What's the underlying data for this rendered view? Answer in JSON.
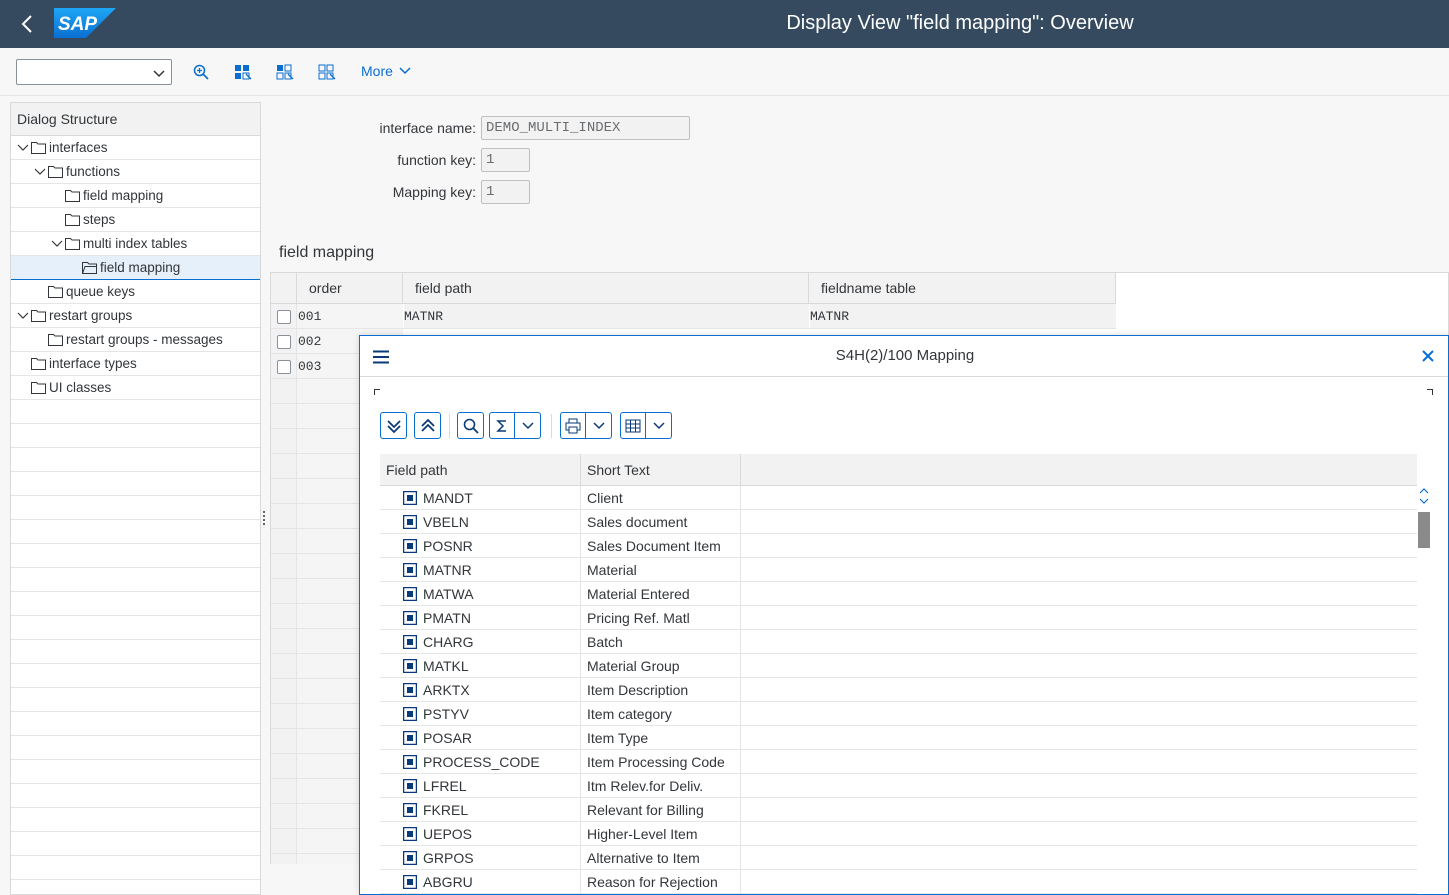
{
  "shell": {
    "logo_text": "SAP",
    "title": "Display View \"field mapping\": Overview"
  },
  "toolbar": {
    "select_value": "",
    "more_label": "More"
  },
  "dialog_structure": {
    "header": "Dialog Structure",
    "items": [
      {
        "label": "interfaces"
      },
      {
        "label": "functions"
      },
      {
        "label": "field mapping"
      },
      {
        "label": "steps"
      },
      {
        "label": "multi index tables"
      },
      {
        "label": "field mapping"
      },
      {
        "label": "queue keys"
      },
      {
        "label": "restart groups"
      },
      {
        "label": "restart groups - messages"
      },
      {
        "label": "interface types"
      },
      {
        "label": "UI classes"
      }
    ]
  },
  "form": {
    "interface_name_label": "interface name:",
    "interface_name_value": "DEMO_MULTI_INDEX",
    "function_key_label": "function key:",
    "function_key_value": "1",
    "mapping_key_label": "Mapping key:",
    "mapping_key_value": "1"
  },
  "section_title": "field mapping",
  "main_table": {
    "columns": [
      "order",
      "field path",
      "fieldname table"
    ],
    "rows": [
      {
        "order": "001",
        "field_path": "MATNR",
        "fieldname_table": "MATNR"
      },
      {
        "order": "002",
        "field_path": "",
        "fieldname_table": ""
      },
      {
        "order": "003",
        "field_path": "",
        "fieldname_table": ""
      }
    ]
  },
  "popup": {
    "title": "S4H(2)/100 Mapping",
    "columns": [
      "Field path",
      "Short Text"
    ],
    "rows": [
      {
        "field": "MANDT",
        "text": "Client"
      },
      {
        "field": "VBELN",
        "text": "Sales document"
      },
      {
        "field": "POSNR",
        "text": "Sales Document Item"
      },
      {
        "field": "MATNR",
        "text": "Material"
      },
      {
        "field": "MATWA",
        "text": "Material Entered"
      },
      {
        "field": "PMATN",
        "text": "Pricing Ref. Matl"
      },
      {
        "field": "CHARG",
        "text": "Batch"
      },
      {
        "field": "MATKL",
        "text": "Material Group"
      },
      {
        "field": "ARKTX",
        "text": "Item Description"
      },
      {
        "field": "PSTYV",
        "text": "Item category"
      },
      {
        "field": "POSAR",
        "text": "Item Type"
      },
      {
        "field": "PROCESS_CODE",
        "text": "Item Processing Code"
      },
      {
        "field": "LFREL",
        "text": "Itm Relev.for Deliv."
      },
      {
        "field": "FKREL",
        "text": "Relevant for Billing"
      },
      {
        "field": "UEPOS",
        "text": "Higher-Level Item"
      },
      {
        "field": "GRPOS",
        "text": "Alternative to Item"
      },
      {
        "field": "ABGRU",
        "text": "Reason for Rejection"
      }
    ]
  },
  "colors": {
    "shell_bg": "#354a5f",
    "accent": "#0a6ed1",
    "field_icon": "#0a3a7a"
  }
}
